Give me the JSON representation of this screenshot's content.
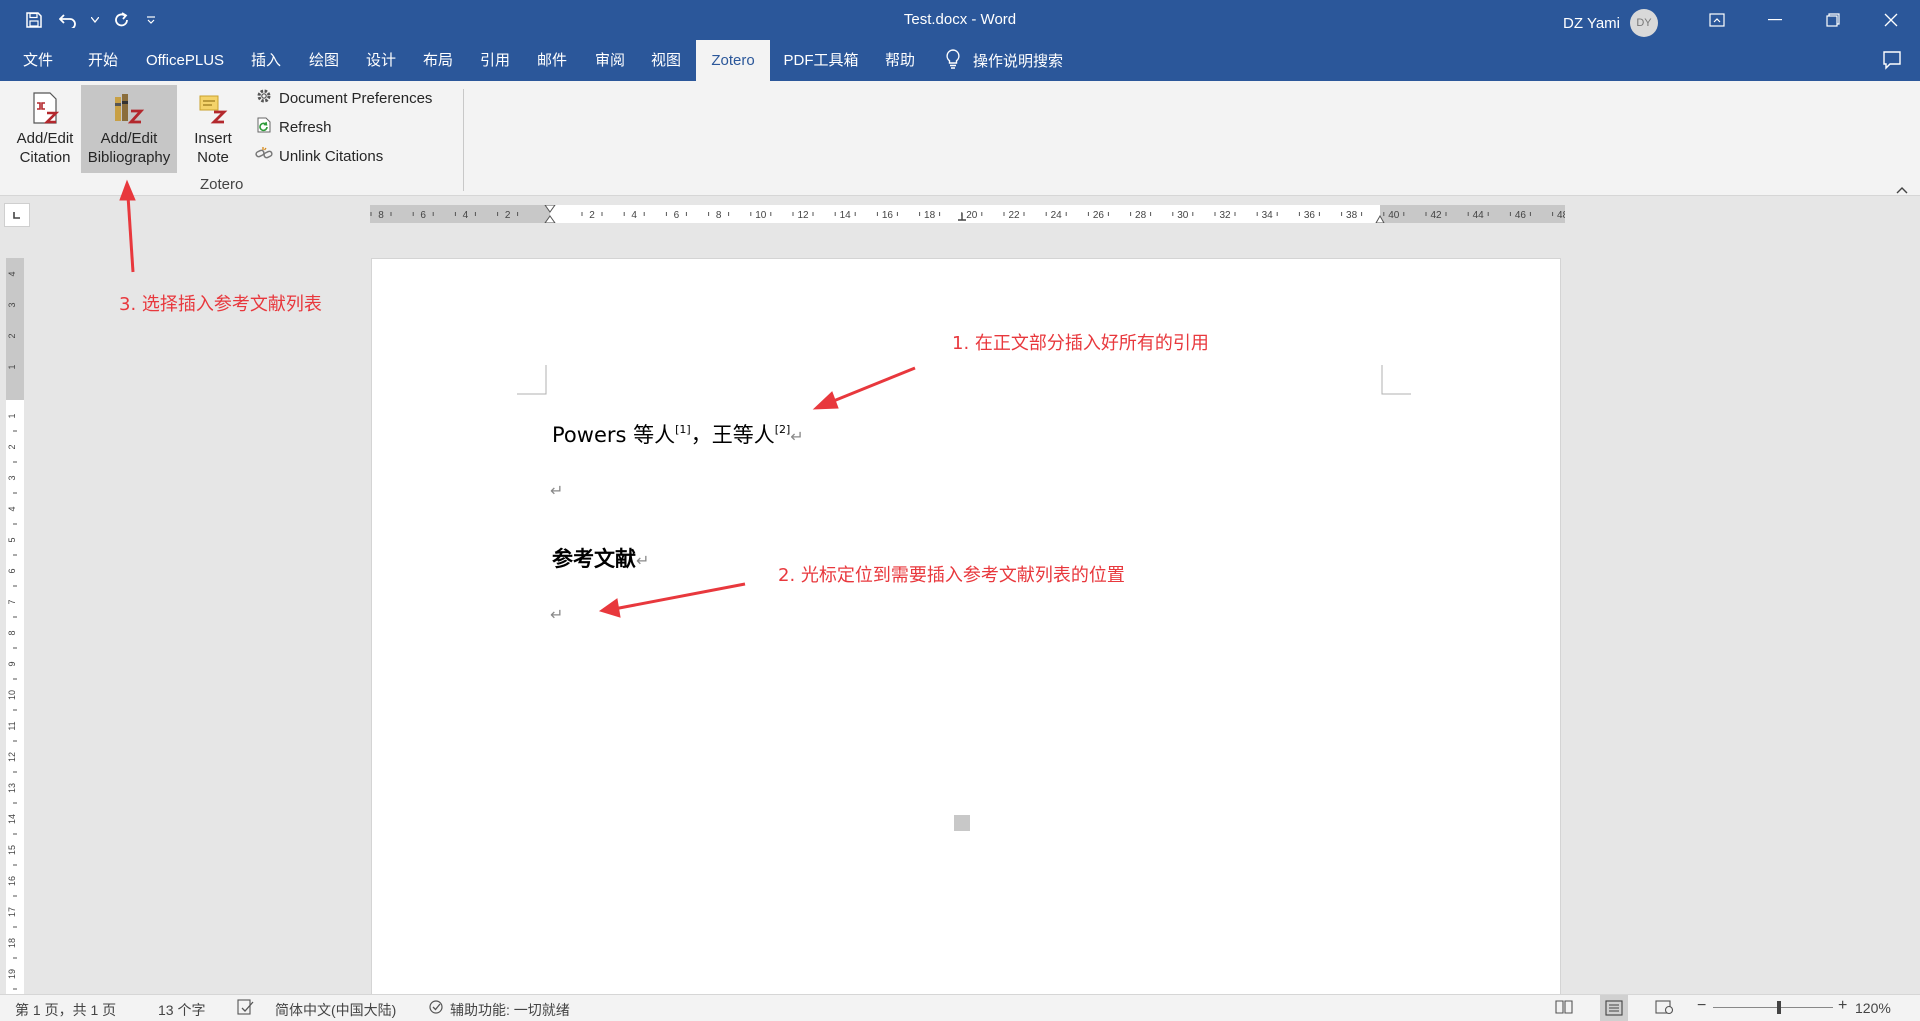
{
  "window": {
    "title": "Test.docx - Word",
    "user_name": "DZ Yami",
    "user_initials": "DY"
  },
  "tabs": [
    "文件",
    "开始",
    "OfficePLUS",
    "插入",
    "绘图",
    "设计",
    "布局",
    "引用",
    "邮件",
    "审阅",
    "视图",
    "Zotero",
    "PDF工具箱",
    "帮助"
  ],
  "tell_me": "操作说明搜索",
  "ribbon": {
    "add_edit_citation": [
      "Add/Edit",
      "Citation"
    ],
    "add_edit_bibliography": [
      "Add/Edit",
      "Bibliography"
    ],
    "insert_note": [
      "Insert",
      "Note"
    ],
    "document_preferences": "Document Preferences",
    "refresh": "Refresh",
    "unlink_citations": "Unlink Citations",
    "group_label": "Zotero"
  },
  "ruler": {
    "h_labels": [
      "8",
      "6",
      "4",
      "2",
      "2",
      "4",
      "6",
      "8",
      "10",
      "12",
      "14",
      "16",
      "18",
      "20",
      "22",
      "24",
      "26",
      "28",
      "30",
      "32",
      "34",
      "36",
      "38",
      "40",
      "42",
      "44",
      "46",
      "48"
    ],
    "v_labels_top": [
      "4",
      "3",
      "2",
      "1"
    ],
    "v_labels": [
      "1",
      "2",
      "3",
      "4",
      "5",
      "6",
      "7",
      "8",
      "9",
      "10",
      "11",
      "12",
      "13",
      "14",
      "15",
      "16",
      "17",
      "18",
      "19"
    ]
  },
  "document": {
    "line1_a": "Powers 等人",
    "cite1": "[1]",
    "line1_b": "，王等人",
    "cite2": "[2]",
    "heading": "参考文献",
    "para_mark": "↵"
  },
  "annotations": {
    "step1": "1. 在正文部分插入好所有的引用",
    "step2": "2. 光标定位到需要插入参考文献列表的位置",
    "step3": "3. 选择插入参考文献列表",
    "arrow_color": "#e8383d"
  },
  "status": {
    "page": "第 1 页，共 1 页",
    "words": "13 个字",
    "language": "简体中文(中国大陆)",
    "accessibility": "辅助功能: 一切就绪",
    "zoom": "120%"
  },
  "colors": {
    "title_bar": "#2b579a",
    "ribbon": "#f3f3f3",
    "annotation": "#e8383d"
  }
}
